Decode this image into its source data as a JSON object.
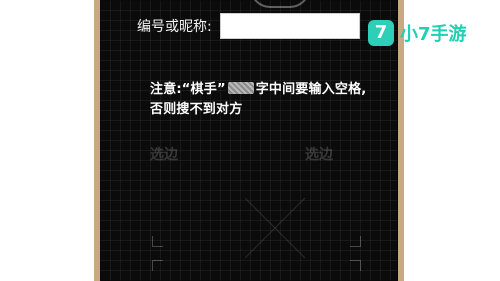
{
  "form": {
    "nickname_label": "编号或昵称:",
    "nickname_value": ""
  },
  "notice": {
    "line1_prefix": "注意:“棋手”",
    "line1_suffix": "字中间要输入空格,",
    "line2": "否则搜不到对方"
  },
  "background_text": {
    "left": "选边",
    "right": "选边"
  },
  "watermark": {
    "mark": "7",
    "text": "小7手游"
  },
  "colors": {
    "panel_background": "#0b0b0b",
    "frame": "#c7a982",
    "accent": "#2ecfb8"
  }
}
